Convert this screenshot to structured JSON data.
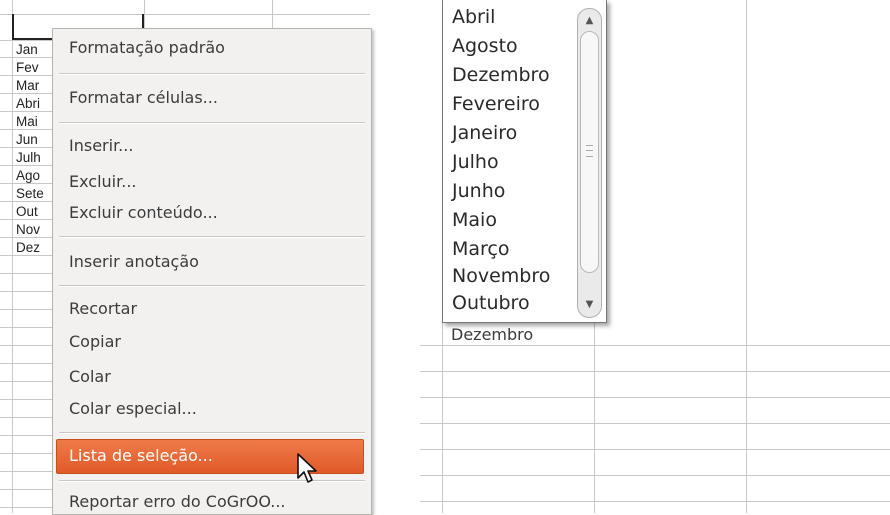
{
  "left": {
    "cells": [
      "Jan",
      "Fev",
      "Mar",
      "Abri",
      "Mai",
      "Jun",
      "Julh",
      "Ago",
      "Sete",
      "Out",
      "Nov",
      "Dez"
    ],
    "context_menu": {
      "items": [
        {
          "label": "Formatação padrão"
        },
        {
          "label": "Formatar células..."
        },
        {
          "label": "Inserir..."
        },
        {
          "label": "Excluir..."
        },
        {
          "label": "Excluir conteúdo..."
        },
        {
          "label": "Inserir anotação"
        },
        {
          "label": "Recortar"
        },
        {
          "label": "Copiar"
        },
        {
          "label": "Colar"
        },
        {
          "label": "Colar especial..."
        },
        {
          "label": "Lista de seleção..."
        },
        {
          "label": "Reportar erro do CoGrOO..."
        }
      ],
      "selected_label": "Lista de seleção..."
    }
  },
  "right": {
    "underlying_cell": "Dezembro",
    "selection_list": [
      "Abril",
      "Agosto",
      "Dezembro",
      "Fevereiro",
      "Janeiro",
      "Julho",
      "Junho",
      "Maio",
      "Março",
      "Novembro",
      "Outubro"
    ]
  },
  "icons": {
    "scroll_up": "arrow-up-icon",
    "scroll_down": "arrow-down-icon",
    "pointer": "mouse-pointer-icon"
  },
  "colors": {
    "highlight": "#e8683a",
    "menu_bg": "#f2f1f0",
    "grid": "#c8c8c8"
  }
}
